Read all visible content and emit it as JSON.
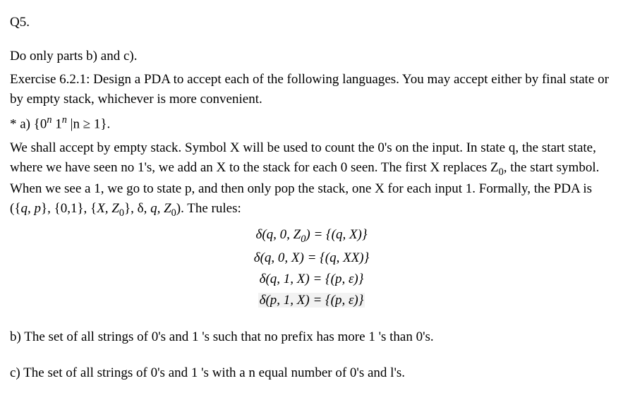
{
  "q_number": "Q5.",
  "instruction": "Do only parts b) and c).",
  "exercise_title": "Exercise 6.2.1: Design a PDA to accept each of the following languages. You may accept either by final state or by empty stack, whichever is more convenient.",
  "part_a_label": "* a) {0",
  "part_a_exp1": "n",
  "part_a_mid": " 1",
  "part_a_exp2": "n",
  "part_a_cond": " |n ≥ 1}.",
  "explanation_1": "We shall accept by empty stack. Symbol X will be used to count the 0's on the input. In state q, the start state, where we have seen no 1's, we add an X to the stack for each 0 seen. The first X replaces Z",
  "explanation_1_sub": "0",
  "explanation_1b": ", the start symbol. When we see a 1, we go to state p, and then only pop the stack, one X for each input 1. Formally, the PDA is ({",
  "explanation_1_pda": "q, p",
  "explanation_1c": "}, {0,1}, {",
  "explanation_1_stack": "X, Z",
  "explanation_1_stack_sub": "0",
  "explanation_1d": "}, δ, ",
  "explanation_1_start": "q, Z",
  "explanation_1_start_sub": "0",
  "explanation_1e": "). The rules:",
  "rule1_l": "δ(q, 0, Z",
  "rule1_sub": "0",
  "rule1_r": ") = {(q, X)}",
  "rule2": "δ(q, 0, X) = {(q, XX)}",
  "rule3": "δ(q, 1, X) = {(p, ε)}",
  "rule4": "δ(p, 1, X) = {(p, ε)}",
  "part_b": "b) The set of all strings of 0's and 1 's such that no prefix has more 1 's than 0's.",
  "part_c": "c) The set of all strings of 0's and 1 's with a n equal number of 0's and l's."
}
